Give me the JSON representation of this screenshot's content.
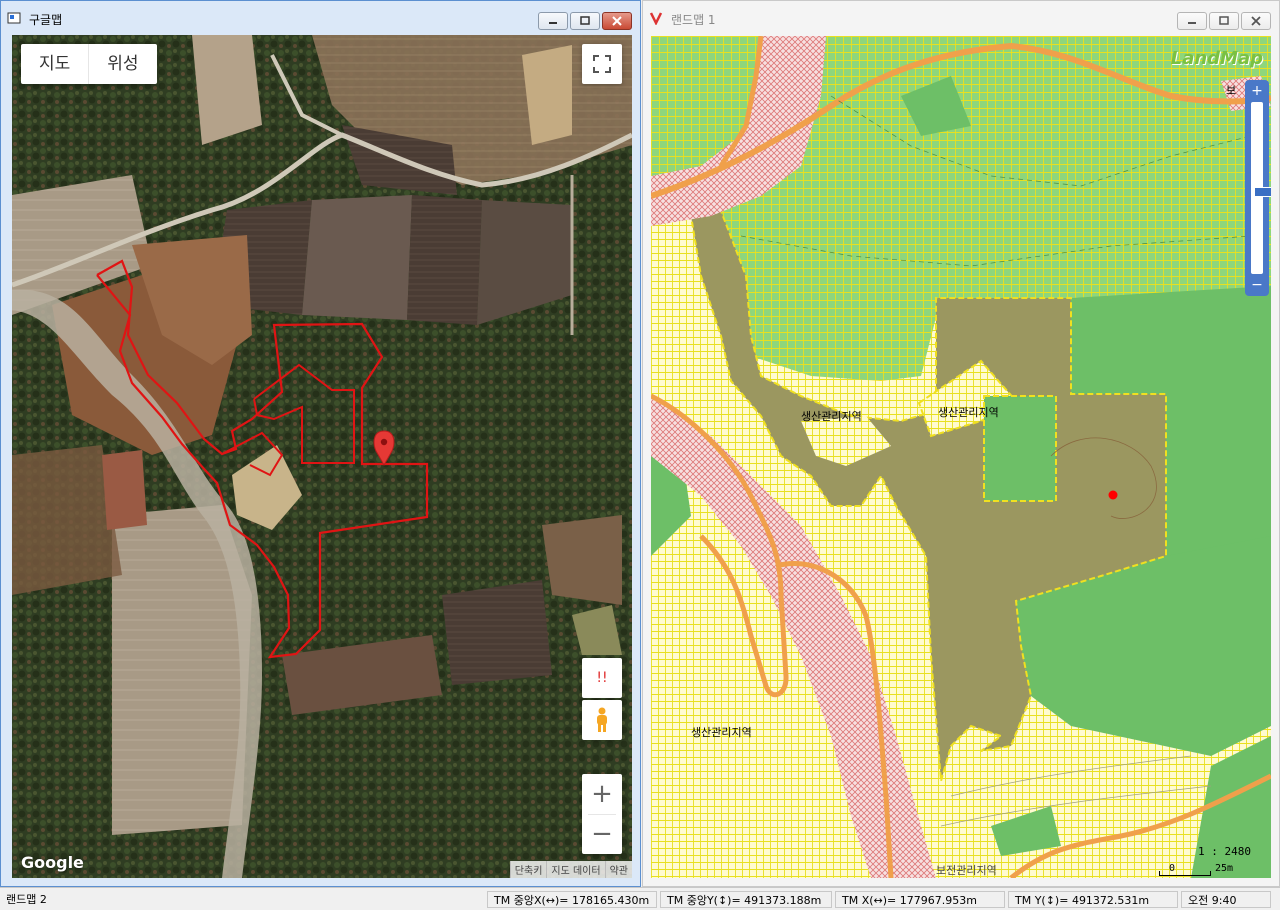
{
  "google_window": {
    "title": "구글맵",
    "map_type": {
      "map": "지도",
      "satellite": "위성"
    },
    "street_view_warning": "!!",
    "zoom_in": "+",
    "zoom_out": "−",
    "logo": "Google",
    "attribution": [
      "단축키",
      "지도 데이터",
      "약관"
    ]
  },
  "landmap_window": {
    "title": "랜드맵 1",
    "logo": "LandMap",
    "zone_labels": [
      "생산관리지역",
      "생산관리지역",
      "생산관리지역"
    ],
    "top_label": "보",
    "bottom_label": "보전관리지역",
    "scale_ratio": "1 : 2480",
    "scale_zero": "0",
    "scale_distance": "25m",
    "zoom_plus": "+",
    "zoom_minus": "−"
  },
  "status_bar": {
    "app": "랜드맵 2",
    "tm_center_x": "TM 중앙X(↔)= 178165.430m",
    "tm_center_y": "TM 중앙Y(↕)= 491373.188m",
    "tm_x": "TM X(↔)= 177967.953m",
    "tm_y": "TM Y(↕)= 491372.531m",
    "clock": "오전 9:40"
  },
  "colors": {
    "google_frame": "#5b8fd0",
    "parcel_outline": "#e01414",
    "marker": "#e53935",
    "landmap_green": "#6dbf67",
    "landmap_olive": "#9b9760",
    "landmap_yellow": "#fffbd0",
    "road_orange": "#f0a04b",
    "river_pink": "#f2c9c9"
  }
}
